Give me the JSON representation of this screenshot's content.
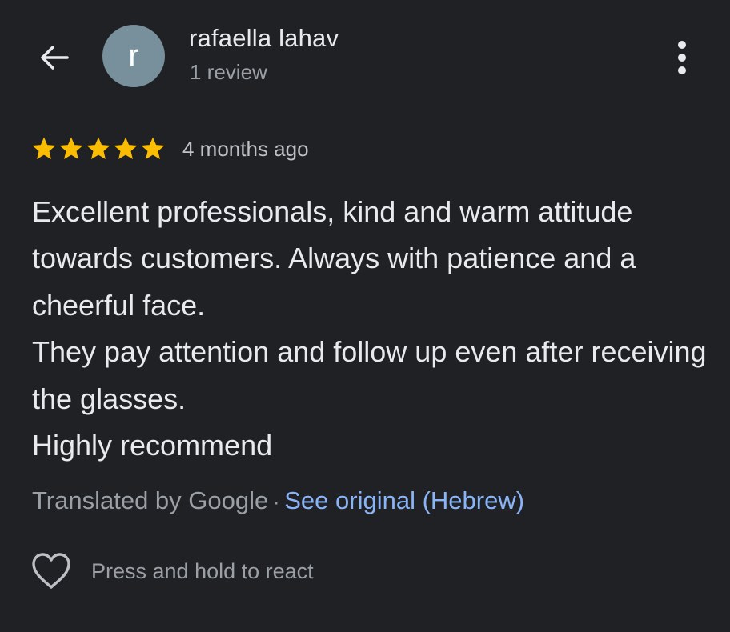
{
  "header": {
    "back_icon": "arrow-back-icon",
    "avatar_initial": "r",
    "avatar_color": "#78909c",
    "reviewer_name": "rafaella lahav",
    "review_count": "1 review",
    "more_icon": "more-vert-icon"
  },
  "review": {
    "rating": 5,
    "max_rating": 5,
    "star_color": "#fbbc04",
    "date": "4 months ago",
    "text": "Excellent professionals, kind and warm attitude towards customers. Always with patience and a cheerful face.\nThey pay attention and follow up even after receiving the glasses.\nHighly recommend"
  },
  "translation": {
    "label": "Translated by Google",
    "separator": "·",
    "see_original": "See original (Hebrew)",
    "link_color": "#8ab4f8"
  },
  "reaction": {
    "icon": "heart-outline-icon",
    "label": "Press and hold to react"
  }
}
